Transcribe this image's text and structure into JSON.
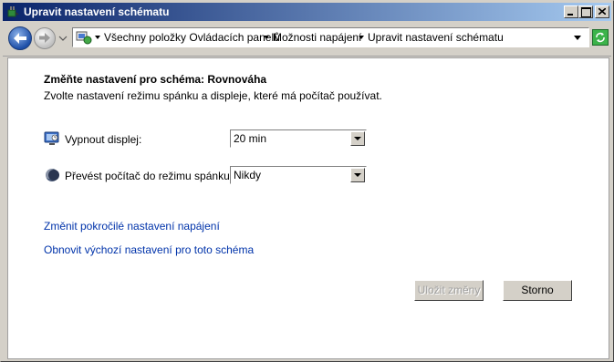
{
  "window": {
    "title": "Upravit nastavení schématu"
  },
  "titlebar_buttons": [
    "minimize",
    "maximize",
    "close"
  ],
  "address": {
    "crumbs": [
      "Všechny položky Ovládacích panelů",
      "Možnosti napájení",
      "Upravit nastavení schématu"
    ]
  },
  "content": {
    "heading": "Změňte nastavení pro schéma: Rovnováha",
    "subtitle": "Zvolte nastavení režimu spánku a displeje, které má počítač používat.",
    "display_off": {
      "label": "Vypnout displej:",
      "value": "20 min"
    },
    "sleep": {
      "label": "Převést počítač do režimu spánku:",
      "value": "Nikdy"
    },
    "link_advanced": "Změnit pokročilé nastavení napájení",
    "link_restore": "Obnovit výchozí nastavení pro toto schéma",
    "save_label": "Uložit změny",
    "cancel_label": "Storno"
  },
  "icons": {
    "title": "power-options-icon",
    "address": "control-panel-icon",
    "display": "monitor-icon",
    "sleep": "moon-icon",
    "refresh": "refresh-icon"
  },
  "colors": {
    "titlebar_start": "#0a246a",
    "titlebar_end": "#a6caf0",
    "link": "#0033aa"
  }
}
